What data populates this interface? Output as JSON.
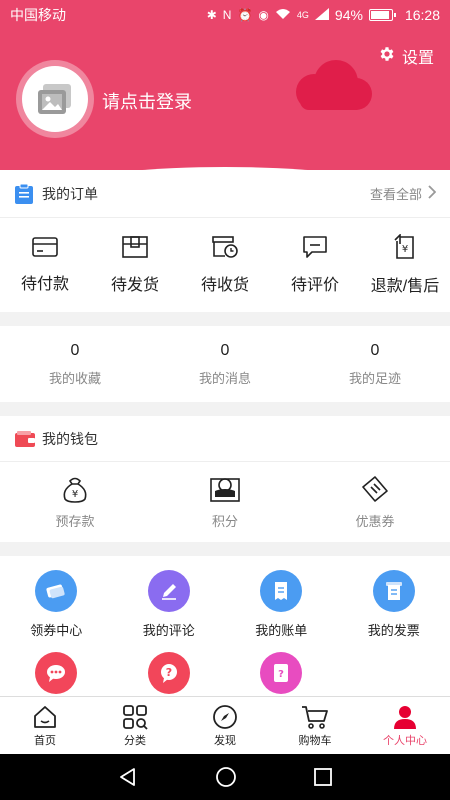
{
  "status_bar": {
    "carrier": "中国移动",
    "signal_label": "4G",
    "battery": "94%",
    "battery_level": 0.94,
    "time": "16:28"
  },
  "header": {
    "settings_label": "设置",
    "login_prompt": "请点击登录",
    "theme_color": "#e9456b",
    "cloud_color": "#e01e4a"
  },
  "orders": {
    "title": "我的订单",
    "view_all": "查看全部",
    "items": [
      {
        "label": "待付款",
        "icon": "card-icon"
      },
      {
        "label": "待发货",
        "icon": "box-icon"
      },
      {
        "label": "待收货",
        "icon": "truck-clock-icon"
      },
      {
        "label": "待评价",
        "icon": "comment-icon"
      },
      {
        "label": "退款/售后",
        "icon": "refund-icon"
      }
    ]
  },
  "stats": [
    {
      "value": "0",
      "label": "我的收藏"
    },
    {
      "value": "0",
      "label": "我的消息"
    },
    {
      "value": "0",
      "label": "我的足迹"
    }
  ],
  "wallet": {
    "title": "我的钱包",
    "items": [
      {
        "label": "预存款",
        "icon": "money-bag-icon"
      },
      {
        "label": "积分",
        "icon": "points-icon"
      },
      {
        "label": "优惠券",
        "icon": "ticket-icon"
      }
    ]
  },
  "services": [
    {
      "label": "领券中心",
      "icon": "coupon-center-icon",
      "color": "#4b9cf2"
    },
    {
      "label": "我的评论",
      "icon": "pencil-icon",
      "color": "#8a6cf0"
    },
    {
      "label": "我的账单",
      "icon": "bill-icon",
      "color": "#4b9cf2"
    },
    {
      "label": "我的发票",
      "icon": "invoice-icon",
      "color": "#4b9cf2"
    },
    {
      "label": "",
      "icon": "chat-icon",
      "color": "#f2465a"
    },
    {
      "label": "",
      "icon": "help-icon",
      "color": "#f2465a"
    },
    {
      "label": "",
      "icon": "feedback-icon",
      "color": "#e84cc0"
    }
  ],
  "tabbar": [
    {
      "label": "首页",
      "icon": "home-icon",
      "active": false
    },
    {
      "label": "分类",
      "icon": "category-icon",
      "active": false
    },
    {
      "label": "发现",
      "icon": "compass-icon",
      "active": false
    },
    {
      "label": "购物车",
      "icon": "cart-icon",
      "active": false
    },
    {
      "label": "个人中心",
      "icon": "user-icon",
      "active": true
    }
  ]
}
